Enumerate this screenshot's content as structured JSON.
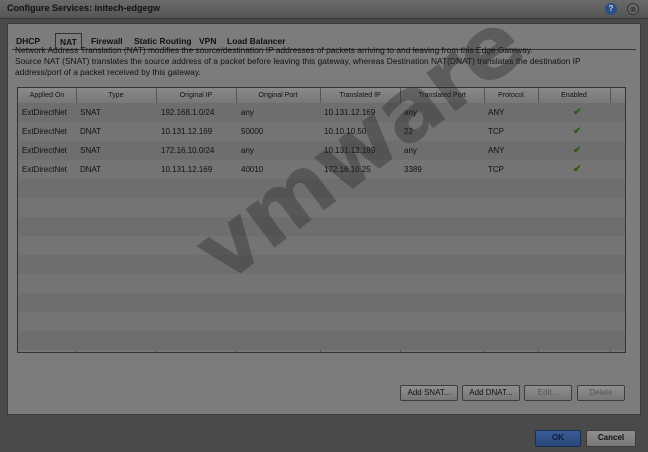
{
  "window": {
    "title": "Configure Services: initech-edgegw",
    "help_icon": "?",
    "close_icon": "⊗"
  },
  "tabs": [
    {
      "label": "DHCP"
    },
    {
      "label": "NAT"
    },
    {
      "label": "Firewall"
    },
    {
      "label": "Static Routing"
    },
    {
      "label": "VPN"
    },
    {
      "label": "Load Balancer"
    }
  ],
  "description": {
    "line1": "Network Address Translation (NAT) modifies the source/destination IP addresses of packets arriving to and leaving from this Edge Gateway.",
    "line2": "Source NAT (SNAT) translates the source address of a packet before leaving this gateway, whereas Destination NAT(DNAT) translates the destination IP",
    "line3": "address/port of a packet received by this gateway."
  },
  "table": {
    "headers": [
      "Applied On",
      "Type",
      "Original IP",
      "Original Port",
      "Translated IP",
      "Translated Port",
      "Protocol",
      "Enabled"
    ],
    "rows": [
      [
        "ExtDirectNet",
        "SNAT",
        "192.168.1.0/24",
        "any",
        "10.131.12.169",
        "any",
        "ANY",
        "✔"
      ],
      [
        "ExtDirectNet",
        "DNAT",
        "10.131.12.169",
        "50000",
        "10.10.10.50",
        "22",
        "TCP",
        "✔"
      ],
      [
        "ExtDirectNet",
        "SNAT",
        "172.16.10.0/24",
        "any",
        "10.131.12.169",
        "any",
        "ANY",
        "✔"
      ],
      [
        "ExtDirectNet",
        "DNAT",
        "10.131.12.169",
        "40010",
        "172.16.10.25",
        "3389",
        "TCP",
        "✔"
      ]
    ]
  },
  "buttons": {
    "add_snat": "Add SNAT...",
    "add_dnat": "Add DNAT...",
    "edit": "Edit...",
    "delete": "Delete",
    "ok": "OK",
    "cancel": "Cancel"
  },
  "watermark": "vmware",
  "colors": {
    "accent": "#2b4779",
    "check": "#2a5a14"
  }
}
